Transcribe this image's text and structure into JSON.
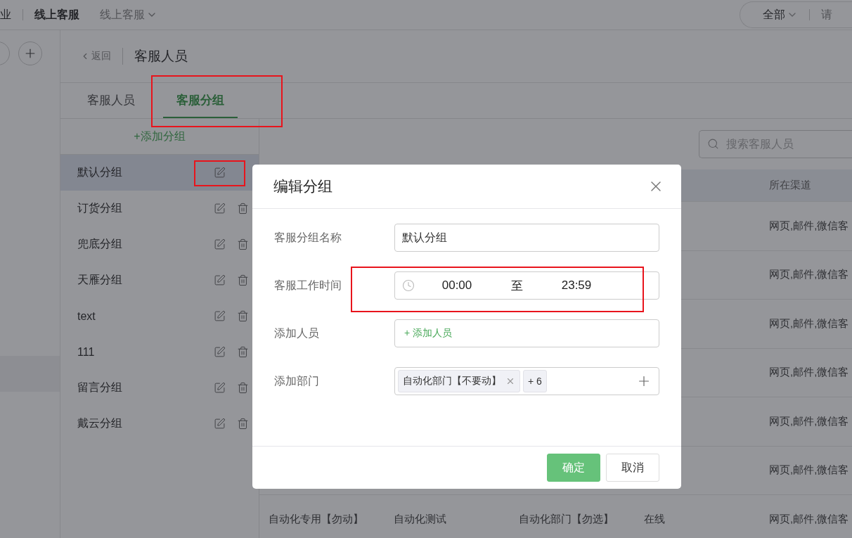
{
  "top_bar": {
    "crumb": "业",
    "title": "线上客服",
    "switcher": "线上客服",
    "filter": "全部",
    "search": "请"
  },
  "header": {
    "back": "返回",
    "title": "客服人员"
  },
  "tabs": [
    {
      "label": "客服人员",
      "selected": false,
      "highlighted": false
    },
    {
      "label": "客服分组",
      "selected": true,
      "highlighted": true
    }
  ],
  "groups": {
    "add": "+添加分组",
    "items": [
      {
        "name": "默认分组",
        "selected": true,
        "deletable": false,
        "highlighted": true
      },
      {
        "name": "订货分组",
        "selected": false,
        "deletable": true,
        "highlighted": false
      },
      {
        "name": "兜底分组",
        "selected": false,
        "deletable": true,
        "highlighted": false
      },
      {
        "name": "天雁分组",
        "selected": false,
        "deletable": true,
        "highlighted": false
      },
      {
        "name": "text",
        "selected": false,
        "deletable": true,
        "highlighted": false
      },
      {
        "name": "111",
        "selected": false,
        "deletable": true,
        "highlighted": false
      },
      {
        "name": "留言分组",
        "selected": false,
        "deletable": true,
        "highlighted": false
      },
      {
        "name": "戴云分组",
        "selected": false,
        "deletable": true,
        "highlighted": false
      }
    ]
  },
  "search": {
    "placeholder": "搜索客服人员"
  },
  "table": {
    "header": {
      "channel": "所在渠道"
    },
    "rows": [
      {
        "channel": "网页,邮件,微信客"
      },
      {
        "channel": "网页,邮件,微信客"
      },
      {
        "channel": "网页,邮件,微信客"
      },
      {
        "channel": "网页,邮件,微信客"
      },
      {
        "channel": "网页,邮件,微信客"
      },
      {
        "channel": "网页,邮件,微信客"
      },
      {
        "column_1": "自动化专用【勿动】",
        "column_2": "自动化测试",
        "column_3": "自动化部门【勿选】",
        "column_4": "在线",
        "channel": "网页,邮件,微信客"
      }
    ]
  },
  "dialog": {
    "title": "编辑分组",
    "fields": [
      {
        "kind": "text",
        "label": "客服分组名称",
        "value": "默认分组",
        "highlighted": false
      },
      {
        "kind": "time_range",
        "label": "客服工作时间",
        "start": "00:00",
        "separator": "至",
        "end": "23:59",
        "highlighted": true
      },
      {
        "kind": "picker",
        "label": "添加人员",
        "action": "+ 添加人员",
        "highlighted": false
      },
      {
        "kind": "tags",
        "label": "添加部门",
        "highlighted": false,
        "tags": [
          {
            "label": "自动化部门【不要动】",
            "removable": true
          },
          {
            "label": "+ 6",
            "removable": false
          }
        ]
      }
    ],
    "buttons": [
      {
        "label": "确定",
        "kind": "primary"
      },
      {
        "label": "取消",
        "kind": "secondary"
      }
    ]
  }
}
